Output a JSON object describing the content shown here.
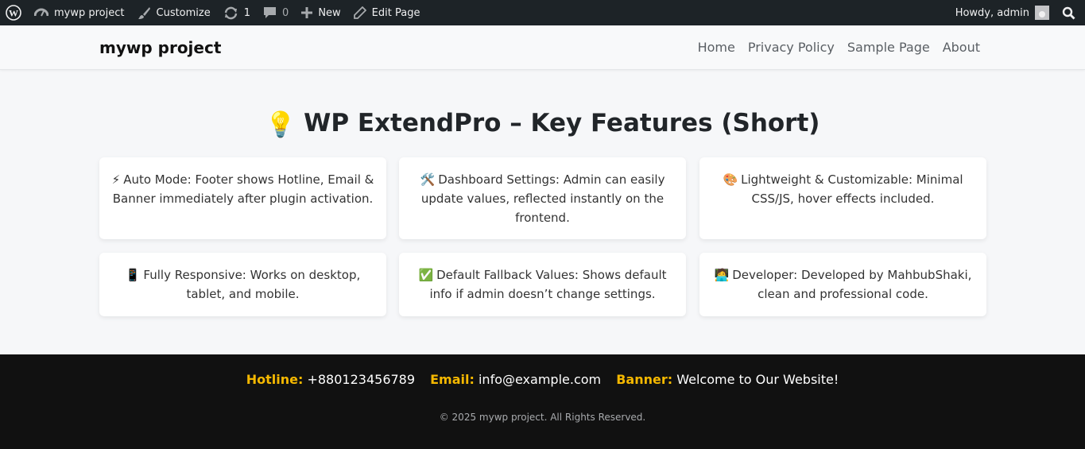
{
  "adminbar": {
    "wp_logo": "wordpress-icon",
    "site_name": "mywp project",
    "customize": "Customize",
    "updates_count": "1",
    "comments_count": "0",
    "new_label": "New",
    "edit_page": "Edit Page",
    "howdy": "Howdy, admin"
  },
  "header": {
    "site_title": "mywp project",
    "nav": [
      "Home",
      "Privacy Policy",
      "Sample Page",
      "About"
    ]
  },
  "main": {
    "title": "WP ExtendPro – Key Features (Short)",
    "title_emoji": "💡",
    "cards": [
      {
        "emoji": "⚡",
        "text": "Auto Mode: Footer shows Hotline, Email & Banner immediately after plugin activation."
      },
      {
        "emoji": "🛠️",
        "text": "Dashboard Settings: Admin can easily update values, reflected instantly on the frontend."
      },
      {
        "emoji": "🎨",
        "text": "Lightweight & Customizable: Minimal CSS/JS, hover effects included."
      },
      {
        "emoji": "📱",
        "text": "Fully Responsive: Works on desktop, tablet, and mobile."
      },
      {
        "emoji": "✅",
        "text": "Default Fallback Values: Shows default info if admin doesn’t change settings."
      },
      {
        "emoji": "🧑‍💻",
        "text": "Developer: Developed by MahbubShaki, clean and professional code."
      }
    ]
  },
  "footer": {
    "hotline_label": "Hotline:",
    "hotline_value": "+880123456789",
    "email_label": "Email:",
    "email_value": "info@example.com",
    "banner_label": "Banner:",
    "banner_value": "Welcome to Our Website!",
    "copyright": "© 2025 mywp project. All Rights Reserved."
  },
  "colors": {
    "adminbar_bg": "#1d2327",
    "footer_bg": "#111111",
    "footer_label": "#f5b800",
    "page_bg": "#f6f7f9"
  }
}
